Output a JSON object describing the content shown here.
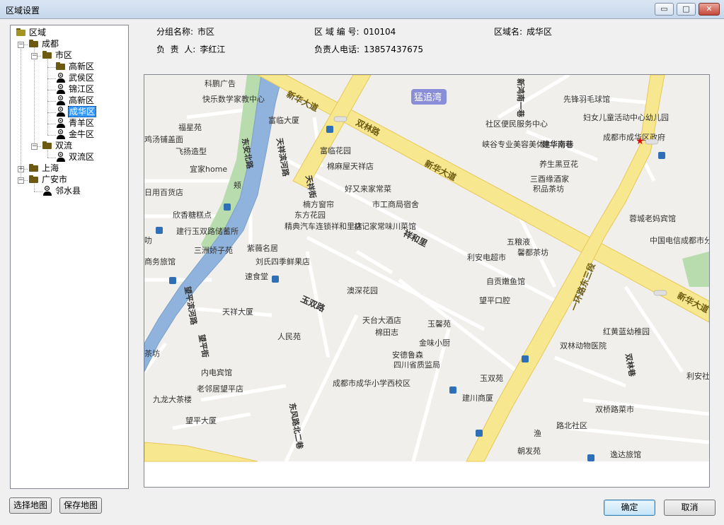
{
  "window": {
    "title": "区域设置"
  },
  "tree": {
    "root": "区域",
    "chengdu": "成都",
    "shiqu": "市区",
    "shiqu_children": [
      "高新区",
      "武侯区",
      "锦江区",
      "高新区",
      "成华区",
      "青羊区",
      "金牛区"
    ],
    "shuangliu": "双流",
    "shuangliu_children": [
      "双流区"
    ],
    "shanghai": "上海",
    "guangan": "广安市",
    "guangan_children": [
      "邻水县"
    ],
    "selected": "成华区"
  },
  "info": {
    "group_label": "分组名称:",
    "group_value": "市区",
    "code_label": "区 域 编 号:",
    "code_value": "010104",
    "area_label": "区域名:",
    "area_value": "成华区",
    "person_label": "负  责  人:",
    "person_value": "李红江",
    "phone_label": "负责人电话:",
    "phone_value": "13857437675"
  },
  "map": {
    "road_labels": [
      "新华大道",
      "双林路",
      "新华大道",
      "祥和里",
      "玉双路",
      "一环路东三段",
      "新华大道",
      "东安北路",
      "天祥滨河路",
      "望平滨河路",
      "天祥街",
      "望平街",
      "东风路北二巷",
      "双林巷",
      "新鸿南一巷",
      "建华南巷"
    ],
    "district_label": "猛追湾",
    "pois": [
      "科鹏广告",
      "快乐数学家教中心",
      "富临大厦",
      "福星苑",
      "鸡汤铺盖面",
      "飞扬造型",
      "宜家home",
      "富临花园",
      "棉麻屋天祥店",
      "好又来家常菜",
      "楠方窗帘",
      "市工商局宿舍",
      "东方花园",
      "精典汽车连锁祥和里店",
      "林记家常味川菜馆",
      "紫薇名居",
      "刘氏四季鲜果店",
      "三洲娇子苑",
      "建行玉双路储蓄所",
      "欣香糖糕点",
      "日用百货店",
      "速食堂",
      "澳深花园",
      "天祥大厦",
      "人民苑",
      "天台大酒店",
      "棉田志",
      "玉馨苑",
      "金味小厨",
      "安德鲁森",
      "四川省质监局",
      "成都市成华小学西校区",
      "内电宾馆",
      "老邻居望平店",
      "九龙大茶楼",
      "望平大厦",
      "社区便民服务中心",
      "峡谷专业美容美体",
      "先锋羽毛球馆",
      "妇女儿童活动中心幼儿园",
      "成都市成华区政府",
      "养生黑豆花",
      "三酉缘酒家",
      "积品茶坊",
      "蓉城老妈宾馆",
      "中国电信成都市分公司",
      "五粮液",
      "馨都茶坊",
      "利安电超市",
      "自贡嫩鱼馆",
      "望平口腔",
      "红黄蓝幼稚园",
      "双林动物医院",
      "玉双苑",
      "建川商厦",
      "双桥路菜市",
      "路北社区",
      "渔",
      "朝发苑",
      "逸达旅馆",
      "利安社市新华",
      "商务旅馆",
      "茶坊",
      "颊",
      "叻"
    ]
  },
  "buttons": {
    "select_map": "选择地图",
    "save_map": "保存地图",
    "ok": "确定",
    "cancel": "取消"
  },
  "window_controls": {
    "minimize": "▭",
    "maximize": "□",
    "close": "✕"
  },
  "colors": {
    "road": "#f7e78e",
    "road_edge": "#e8c95a",
    "river": "#8fb3dc",
    "park": "#b8dcae",
    "map_bg": "#f0efeb",
    "selected": "#3399ff"
  }
}
